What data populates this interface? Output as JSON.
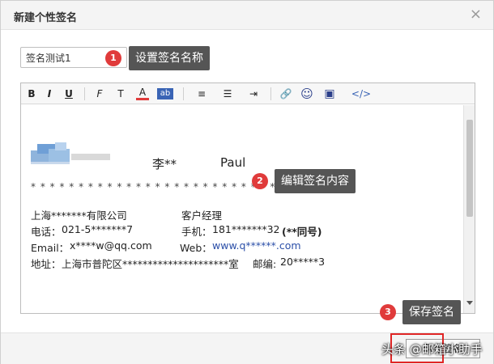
{
  "dialog": {
    "title": "新建个性签名",
    "close_glyph": "×"
  },
  "name_field": {
    "value": "签名测试1"
  },
  "callouts": [
    {
      "number": "1",
      "text": "设置签名名称"
    },
    {
      "number": "2",
      "text": "编辑签名内容"
    },
    {
      "number": "3",
      "text": "保存签名"
    }
  ],
  "toolbar": {
    "bold": "B",
    "italic": "I",
    "underline": "U",
    "font_family": "F",
    "font_size": "T",
    "font_color": "A",
    "bg_color": "ab",
    "align": "≡",
    "list": "☰",
    "indent": "⇥",
    "link": "🔗",
    "emoji": "☺",
    "image": "▣",
    "source": "</>"
  },
  "signature": {
    "name_cn": "李**",
    "name_en": "Paul",
    "separator": "* * * * * * * * * * * * * * * * * * * * * * * * * * * * * * * * * *",
    "company": "上海*******有限公司",
    "position": "客户经理",
    "phone_label": "电话：",
    "phone": "021-5*******7",
    "mobile_label": "手机：",
    "mobile": "181*******32",
    "mobile_note": "(**同号)",
    "email_label": "Email：",
    "email": "x****w@qq.com",
    "web_label": "Web：",
    "web": "www.q******.com",
    "address_label": "地址：",
    "address": "上海市普陀区*********************室",
    "zip_label": "邮编:",
    "zip": "20*****3"
  },
  "footer": {
    "save_label": "保存签名",
    "watermark": "头条 @邮箱小助手"
  },
  "colors": {
    "accent_red": "#e03b3b",
    "tip_bg": "#555555",
    "link_blue": "#2b4fa8"
  }
}
